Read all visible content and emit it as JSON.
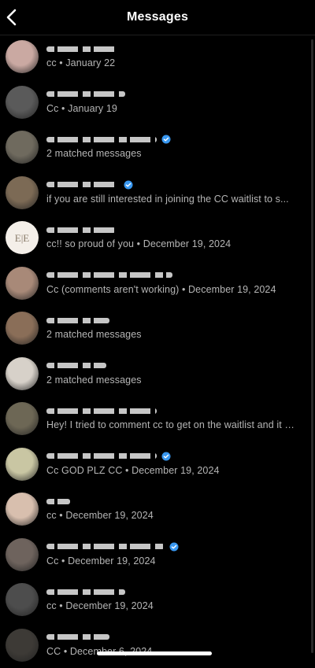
{
  "header": {
    "title": "Messages",
    "back_icon": "chevron-left-icon"
  },
  "conversations": [
    {
      "preview": "cc • January 22",
      "verified": false,
      "avatar_color": "#caa9a2"
    },
    {
      "preview": "Cc • January 19",
      "verified": false,
      "avatar_color": "#5a5a5a"
    },
    {
      "preview": "2 matched messages",
      "verified": true,
      "avatar_color": "#6f6a5e"
    },
    {
      "preview": "if you are still interested in joining the CC waitlist to s...",
      "verified": true,
      "avatar_color": "#7c6a55"
    },
    {
      "preview": "cc!! so proud of you • December 19, 2024",
      "verified": false,
      "avatar_color": "#f2ece6"
    },
    {
      "preview": "Cc (comments aren't working) • December 19, 2024",
      "verified": false,
      "avatar_color": "#a88978"
    },
    {
      "preview": "2 matched messages",
      "verified": false,
      "avatar_color": "#8a6e58"
    },
    {
      "preview": "2 matched messages",
      "verified": false,
      "avatar_color": "#d7d1c9"
    },
    {
      "preview": "Hey! I tried to comment cc to get on the waitlist and it w...",
      "verified": false,
      "avatar_color": "#6d6755"
    },
    {
      "preview": "Cc GOD PLZ CC • December 19, 2024",
      "verified": true,
      "avatar_color": "#c9c6a3"
    },
    {
      "preview": "cc • December 19, 2024",
      "verified": false,
      "avatar_color": "#d8bfae"
    },
    {
      "preview": "Cc • December 19, 2024",
      "verified": true,
      "avatar_color": "#6e635d"
    },
    {
      "preview": "cc • December 19, 2024",
      "verified": false,
      "avatar_color": "#4d4d4d"
    },
    {
      "preview": "CC • December 6, 2024",
      "verified": false,
      "avatar_color": "#3d3a36"
    }
  ],
  "colors": {
    "background": "#000000",
    "text_primary": "#ffffff",
    "text_secondary": "#b5b5b5",
    "verified_badge": "#3897f0"
  }
}
